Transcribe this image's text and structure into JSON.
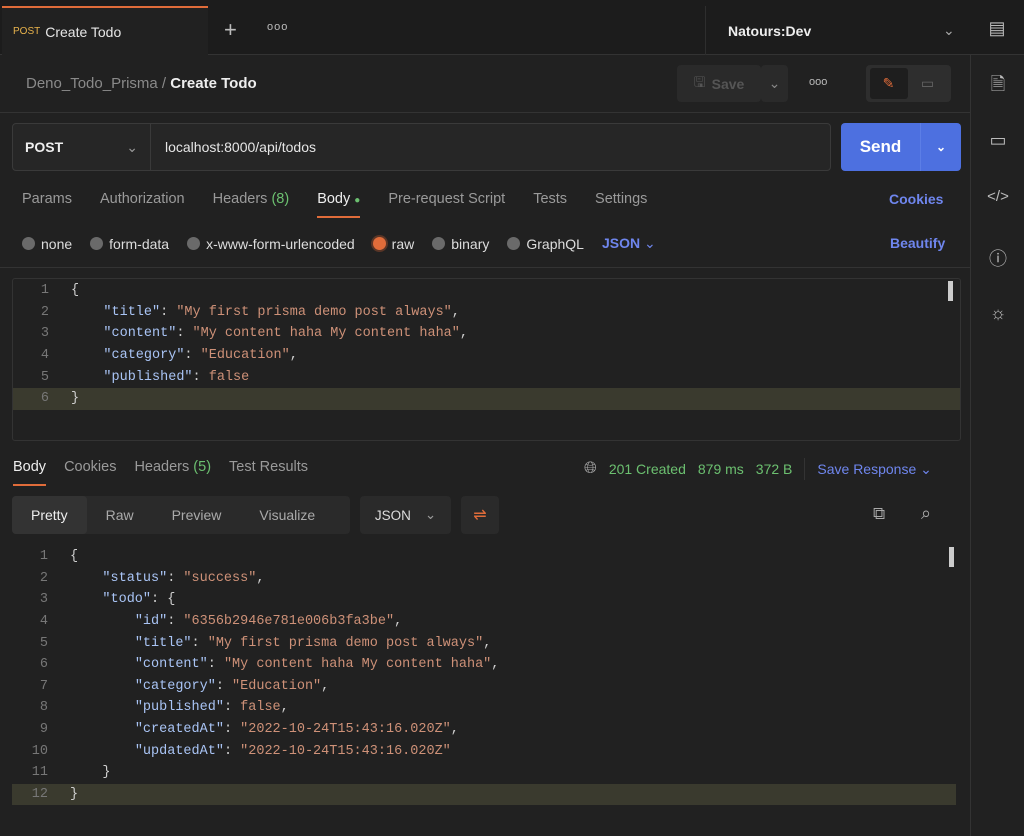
{
  "tab": {
    "method": "POST",
    "title": "Create Todo"
  },
  "environment": "Natours:Dev",
  "breadcrumb": {
    "collection": "Deno_Todo_Prisma",
    "separator": "/",
    "request": "Create Todo"
  },
  "toolbar": {
    "save_label": "Save"
  },
  "request": {
    "method": "POST",
    "url": "localhost:8000/api/todos",
    "send_label": "Send"
  },
  "request_tabs": [
    {
      "label": "Params"
    },
    {
      "label": "Authorization"
    },
    {
      "label": "Headers",
      "count": "(8)"
    },
    {
      "label": "Body"
    },
    {
      "label": "Pre-request Script"
    },
    {
      "label": "Tests"
    },
    {
      "label": "Settings"
    }
  ],
  "cookies_link": "Cookies",
  "body_types": [
    "none",
    "form-data",
    "x-www-form-urlencoded",
    "raw",
    "binary",
    "GraphQL"
  ],
  "body_selected": "raw",
  "body_format": "JSON",
  "beautify": "Beautify",
  "request_body": [
    [
      [
        "p",
        "{"
      ]
    ],
    [
      [
        "p",
        "    "
      ],
      [
        "k",
        "\"title\""
      ],
      [
        "p",
        ": "
      ],
      [
        "s",
        "\"My first prisma demo post always\""
      ],
      [
        "p",
        ","
      ]
    ],
    [
      [
        "p",
        "    "
      ],
      [
        "k",
        "\"content\""
      ],
      [
        "p",
        ": "
      ],
      [
        "s",
        "\"My content haha My content haha\""
      ],
      [
        "p",
        ","
      ]
    ],
    [
      [
        "p",
        "    "
      ],
      [
        "k",
        "\"category\""
      ],
      [
        "p",
        ": "
      ],
      [
        "s",
        "\"Education\""
      ],
      [
        "p",
        ","
      ]
    ],
    [
      [
        "p",
        "    "
      ],
      [
        "k",
        "\"published\""
      ],
      [
        "p",
        ": "
      ],
      [
        "s",
        "false"
      ]
    ],
    [
      [
        "p",
        "}"
      ]
    ]
  ],
  "response_tabs": [
    {
      "label": "Body"
    },
    {
      "label": "Cookies"
    },
    {
      "label": "Headers",
      "count": "(5)"
    },
    {
      "label": "Test Results"
    }
  ],
  "response_status": {
    "status": "201 Created",
    "time": "879 ms",
    "size": "372 B",
    "save": "Save Response"
  },
  "view_modes": [
    "Pretty",
    "Raw",
    "Preview",
    "Visualize"
  ],
  "response_format": "JSON",
  "response_body": [
    [
      [
        "p",
        "{"
      ]
    ],
    [
      [
        "p",
        "    "
      ],
      [
        "k",
        "\"status\""
      ],
      [
        "p",
        ": "
      ],
      [
        "s",
        "\"success\""
      ],
      [
        "p",
        ","
      ]
    ],
    [
      [
        "p",
        "    "
      ],
      [
        "k",
        "\"todo\""
      ],
      [
        "p",
        ": {"
      ]
    ],
    [
      [
        "p",
        "        "
      ],
      [
        "k",
        "\"id\""
      ],
      [
        "p",
        ": "
      ],
      [
        "s",
        "\"6356b2946e781e006b3fa3be\""
      ],
      [
        "p",
        ","
      ]
    ],
    [
      [
        "p",
        "        "
      ],
      [
        "k",
        "\"title\""
      ],
      [
        "p",
        ": "
      ],
      [
        "s",
        "\"My first prisma demo post always\""
      ],
      [
        "p",
        ","
      ]
    ],
    [
      [
        "p",
        "        "
      ],
      [
        "k",
        "\"content\""
      ],
      [
        "p",
        ": "
      ],
      [
        "s",
        "\"My content haha My content haha\""
      ],
      [
        "p",
        ","
      ]
    ],
    [
      [
        "p",
        "        "
      ],
      [
        "k",
        "\"category\""
      ],
      [
        "p",
        ": "
      ],
      [
        "s",
        "\"Education\""
      ],
      [
        "p",
        ","
      ]
    ],
    [
      [
        "p",
        "        "
      ],
      [
        "k",
        "\"published\""
      ],
      [
        "p",
        ": "
      ],
      [
        "s",
        "false"
      ],
      [
        "p",
        ","
      ]
    ],
    [
      [
        "p",
        "        "
      ],
      [
        "k",
        "\"createdAt\""
      ],
      [
        "p",
        ": "
      ],
      [
        "s",
        "\"2022-10-24T15:43:16.020Z\""
      ],
      [
        "p",
        ","
      ]
    ],
    [
      [
        "p",
        "        "
      ],
      [
        "k",
        "\"updatedAt\""
      ],
      [
        "p",
        ": "
      ],
      [
        "s",
        "\"2022-10-24T15:43:16.020Z\""
      ]
    ],
    [
      [
        "p",
        "    }"
      ]
    ],
    [
      [
        "p",
        "}"
      ]
    ]
  ],
  "colors": {
    "accent": "#e06c3a",
    "send": "#4d70e0",
    "link": "#6f86ee",
    "success": "#6cc070",
    "key": "#a9c4f5",
    "string": "#ce9178"
  }
}
